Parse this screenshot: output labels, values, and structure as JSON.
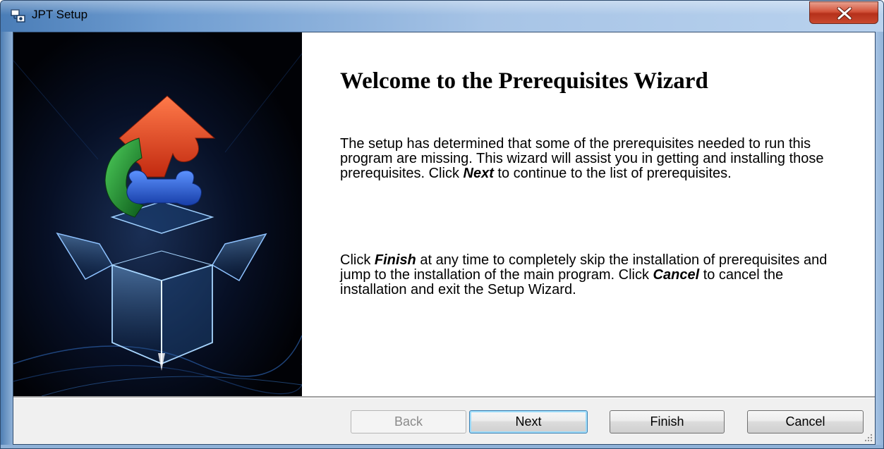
{
  "window": {
    "title": "JPT Setup",
    "close_glyph": "✕"
  },
  "content": {
    "heading": "Welcome to the Prerequisites Wizard",
    "para1": {
      "before": "The setup has determined that some of the prerequisites needed to run this program are missing. This wizard will assist you in getting and installing those prerequisites. Click ",
      "emph": "Next",
      "after": "  to continue to the list of prerequisites."
    },
    "para2": {
      "t1": "Click ",
      "e1": "Finish",
      "t2": " at any time to completely skip the installation of prerequisites and jump to the installation of the main program. Click ",
      "e2": "Cancel",
      "t3": " to cancel the installation and exit the Setup Wizard."
    }
  },
  "buttons": {
    "back": "Back",
    "next": "Next",
    "finish": "Finish",
    "cancel": "Cancel"
  },
  "icons": {
    "app": "setup-app-icon",
    "close": "close-icon",
    "graphic": "puzzle-box-graphic",
    "grip": "resize-grip-icon"
  },
  "colors": {
    "titlebar": "#6e9cd0",
    "close": "#c9492f",
    "next_focus": "#3c7fb1",
    "puzzle_red": "#e2401e",
    "puzzle_green": "#1f8a2e",
    "puzzle_blue": "#1f56c8"
  }
}
